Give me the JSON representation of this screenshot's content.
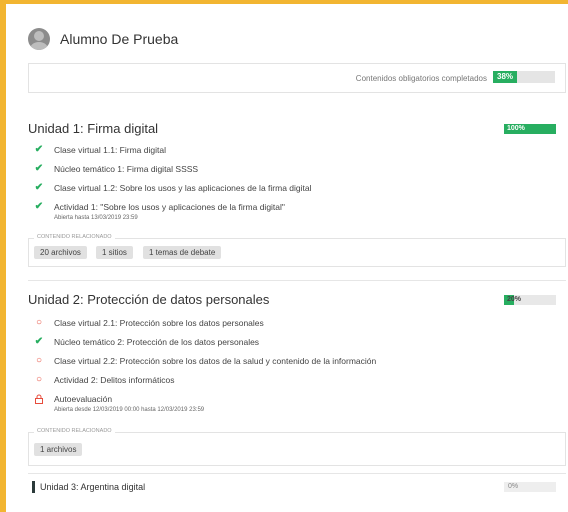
{
  "student": {
    "name": "Alumno De Prueba"
  },
  "progress": {
    "label": "Contenidos obligatorios completados",
    "value_text": "38%",
    "value": 0.38
  },
  "units": [
    {
      "title": "Unidad 1: Firma digital",
      "progress_text": "100%",
      "progress": 1.0,
      "items": [
        {
          "icon": "check-icon",
          "text": "Clase virtual 1.1: Firma digital"
        },
        {
          "icon": "check-icon",
          "text": "Núcleo temático 1: Firma digital SSSS"
        },
        {
          "icon": "check-icon",
          "text": "Clase virtual 1.2: Sobre los usos y las aplicaciones de la firma digital"
        },
        {
          "icon": "check-icon",
          "text": "Actividad 1: \"Sobre los usos y aplicaciones de la firma digital\"",
          "sub": "Abierta hasta 13/03/2019 23:59"
        }
      ],
      "related_label": "CONTENIDO RELACIONADO",
      "related": [
        "20 archivos",
        "1 sitios",
        "1 temas de debate"
      ]
    },
    {
      "title": "Unidad 2: Protección de datos personales",
      "progress_text": "20%",
      "progress": 0.2,
      "items": [
        {
          "icon": "circle-icon",
          "text": "Clase virtual 2.1: Protección sobre los datos personales"
        },
        {
          "icon": "check-icon",
          "text": "Núcleo temático 2: Protección de los datos personales"
        },
        {
          "icon": "circle-icon",
          "text": "Clase virtual 2.2: Protección sobre los datos de la salud y contenido de la información"
        },
        {
          "icon": "circle-icon",
          "text": "Actividad 2: Delitos informáticos"
        },
        {
          "icon": "lock-icon",
          "text": "Autoevaluación",
          "sub": "Abierta desde 12/03/2019 00:00 hasta 12/03/2019 23:59"
        }
      ],
      "related_label": "CONTENIDO RELACIONADO",
      "related": [
        "1 archivos"
      ]
    },
    {
      "title": "Unidad 3: Argentina digital",
      "progress_text": "0%",
      "progress": 0.0
    }
  ],
  "colors": {
    "accent_border": "#f2b531",
    "complete": "#27ae60",
    "pending": "#e74c3c"
  }
}
